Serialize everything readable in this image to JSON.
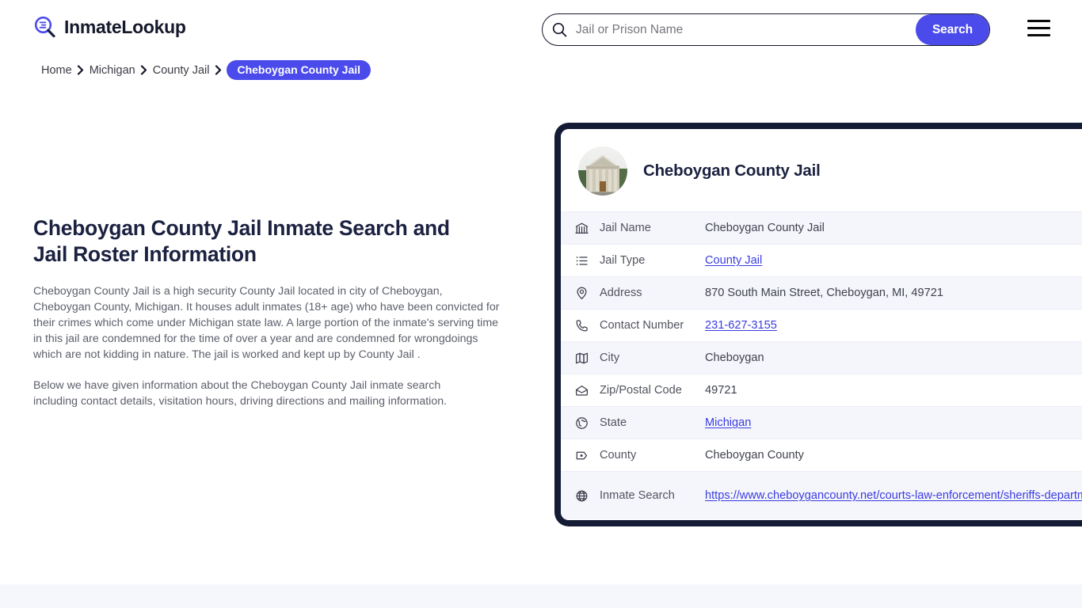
{
  "header": {
    "logo_text": "InmateLookup",
    "logo_icon": "magnifier-list-icon",
    "search": {
      "placeholder": "Jail or Prison Name",
      "value": "",
      "icon": "search-icon",
      "button_label": "Search"
    },
    "menu_icon": "hamburger-menu-icon",
    "accent_color": "#4b4bec"
  },
  "breadcrumb": {
    "items": [
      {
        "label": "Home",
        "current": false
      },
      {
        "label": "Michigan",
        "current": false
      },
      {
        "label": "County Jail",
        "current": false
      },
      {
        "label": "Cheboygan County Jail",
        "current": true
      }
    ],
    "separator": "chevron-right-icon"
  },
  "main": {
    "title": "Cheboygan County Jail Inmate Search and Jail Roster Information",
    "paragraphs": [
      "Cheboygan County Jail is a high security County Jail located in city of Cheboygan, Cheboygan County, Michigan. It houses adult inmates (18+ age) who have been convicted for their crimes which come under Michigan state law. A large portion of the inmate's serving time in this jail are condemned for the time of over a year and are condemned for wrongdoings which are not kidding in nature. The jail is worked and kept up by County Jail .",
      "Below we have given information about the Cheboygan County Jail inmate search including contact details, visitation hours, driving directions and mailing information."
    ]
  },
  "card": {
    "thumbnail_icon": "courthouse-photo",
    "title": "Cheboygan County Jail",
    "border_color": "#141b34",
    "rows": [
      {
        "icon": "bank-icon",
        "label": "Jail Name",
        "value": "Cheboygan County Jail",
        "link": false
      },
      {
        "icon": "list-icon",
        "label": "Jail Type",
        "value": "County Jail",
        "link": true
      },
      {
        "icon": "map-pin-icon",
        "label": "Address",
        "value": "870 South Main Street, Cheboygan, MI, 49721",
        "link": false
      },
      {
        "icon": "phone-icon",
        "label": "Contact Number",
        "value": "231-627-3155",
        "link": true
      },
      {
        "icon": "map-icon",
        "label": "City",
        "value": "Cheboygan",
        "link": false
      },
      {
        "icon": "envelope-icon",
        "label": "Zip/Postal Code",
        "value": "49721",
        "link": false
      },
      {
        "icon": "globe-icon",
        "label": "State",
        "value": "Michigan",
        "link": true
      },
      {
        "icon": "county-map-icon",
        "label": "County",
        "value": "Cheboygan County",
        "link": false
      },
      {
        "icon": "web-globe-icon",
        "label": "Inmate Search",
        "value": "https://www.cheboygancounty.net/courts-law-enforcement/sheriffs-department/",
        "link": true
      }
    ]
  }
}
